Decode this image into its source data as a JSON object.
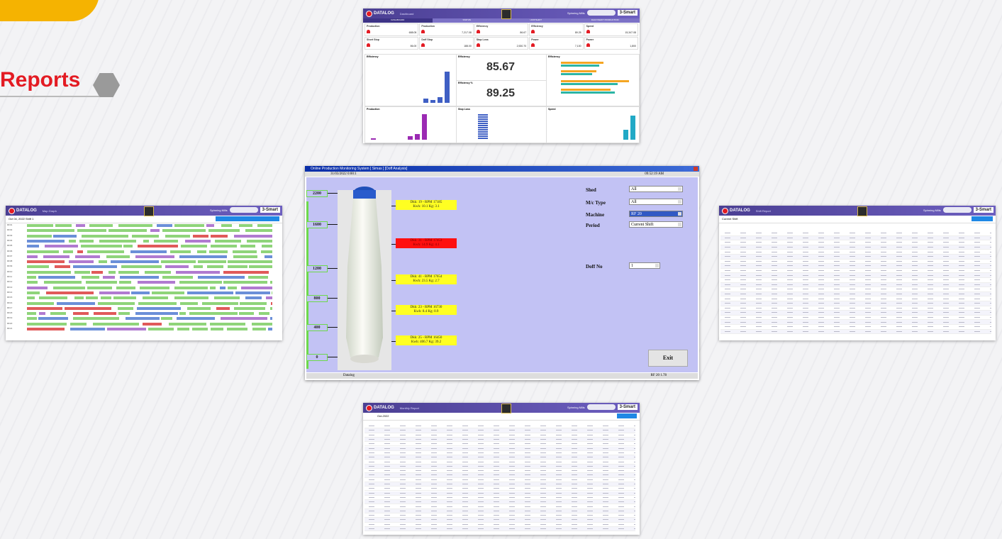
{
  "section": {
    "title": "Reports"
  },
  "dashboard": {
    "brand": "DATALOG",
    "page": "Dashboard",
    "mill_label": "Spinning Mills",
    "smart": "3-Smart",
    "tabs": [
      "DASHBOARD",
      "STATUS",
      "UNIT/SHIFT",
      "DAILY/SHIFT PRODUCTION"
    ],
    "kpis": [
      {
        "title": "Production",
        "value": "688.05"
      },
      {
        "title": "Production",
        "value": "7,217.08"
      },
      {
        "title": "Efficiency",
        "value": "86.67"
      },
      {
        "title": "Efficiency",
        "value": "89.25"
      },
      {
        "title": "Speed",
        "value": "15,347.08"
      },
      {
        "title": "Short Stop",
        "value": "86.00"
      },
      {
        "title": "Doff Stop",
        "value": "188.00"
      },
      {
        "title": "Stop Loss",
        "value": "2,530.70"
      },
      {
        "title": "Power",
        "value": "7,100"
      },
      {
        "title": "Power",
        "value": "1,800"
      }
    ],
    "panels": {
      "efficiency": "Efficiency",
      "efficiency_pct": "Efficiency %",
      "production": "Production",
      "stop_loss": "Stop Loss",
      "speed": "Speed"
    },
    "big_efficiency_1": "85.67",
    "big_efficiency_2": "89.25"
  },
  "map_report": {
    "brand": "DATALOG",
    "page": "Map Graph",
    "smart": "3-Smart",
    "mill_label": "Spinning Mills",
    "date": "Oct 04, 2022 Shift 1",
    "machine_col": [
      "RF01",
      "RF02",
      "RF03",
      "RF04",
      "RF05",
      "RF06",
      "RF07",
      "RF08",
      "RF09",
      "RF10",
      "RF11",
      "RF12",
      "RF13",
      "RF14",
      "RF15",
      "RF16",
      "RF17",
      "RF18",
      "RF19",
      "RF20",
      "RF21"
    ]
  },
  "shift_report": {
    "brand": "DATALOG",
    "page": "Shift Report",
    "smart": "3-Smart",
    "mill_label": "Spinning Mills",
    "shift": "Current Shift"
  },
  "monthly_report": {
    "brand": "DATALOG",
    "page": "Monthly Report",
    "smart": "3-Smart",
    "mill_label": "Spinning Mills",
    "month": "Oct-2022"
  },
  "monitor": {
    "title": "Online Production Monitoring System [ Simas ]  [Doff Analysis]",
    "datetime": "31/03/2022 0:00:1",
    "time_right": "09:52:19 AM",
    "scale": [
      "2200",
      "1600",
      "1200",
      "800",
      "400",
      "0"
    ],
    "doffs": [
      {
        "line1": "Dkk: 19 - RPM 17185",
        "line2": "Kwh: 10.1  Kg: 3.1",
        "alert": false
      },
      {
        "line1": "Dkk: 31 - RPM 17453",
        "line2": "Kwh: 14.9  Kg: 4.1",
        "alert": true
      },
      {
        "line1": "Dkk: 41 - RPM 17654",
        "line2": "Kwh: 23.5  Kg: 2.7",
        "alert": false
      },
      {
        "line1": "Dkk: 23 - RPM 16730",
        "line2": "Kwh: 8.4  Kg: 0.9",
        "alert": false
      },
      {
        "line1": "Dkk: 25 - RPM 16450",
        "line2": "Kwh: 406.7  Kg: 39.2",
        "alert": false
      }
    ],
    "filters": [
      {
        "label": "Shed",
        "value": "All",
        "highlight": false
      },
      {
        "label": "M/c Type",
        "value": "All",
        "highlight": false
      },
      {
        "label": "Machine",
        "value": "RF 20",
        "highlight": true
      },
      {
        "label": "Period",
        "value": "Current Shift",
        "highlight": false
      }
    ],
    "doff_no_label": "Doff No",
    "doff_no_value": "1",
    "exit_label": "Exit",
    "status_left": "Datalog",
    "status_right": "RF 20  1.78"
  },
  "colors": {
    "brand_purple": "#4b3f93",
    "accent_red": "#e31b23",
    "accent_yellow": "#f5b301",
    "gantt_green": "#8fd47a",
    "canvas": "#c2c2f4"
  }
}
